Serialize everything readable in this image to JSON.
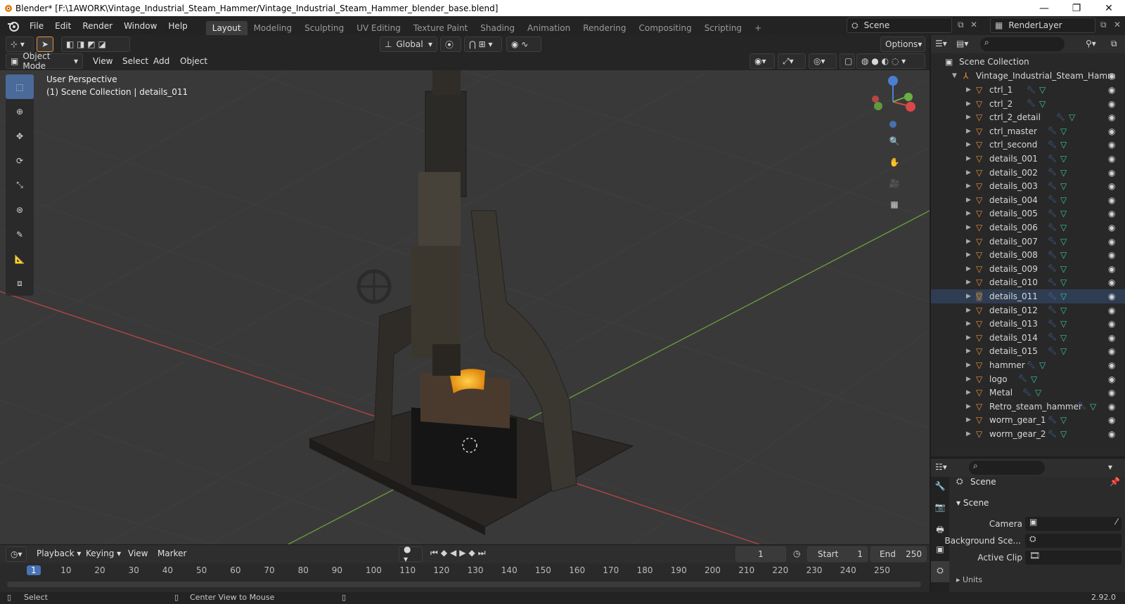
{
  "window": {
    "title": "Blender* [F:\\1AWORK\\Vintage_Industrial_Steam_Hammer/Vintage_Industrial_Steam_Hammer_blender_base.blend]",
    "minimize": "—",
    "restore": "❐",
    "close": "✕"
  },
  "menu": [
    "File",
    "Edit",
    "Render",
    "Window",
    "Help"
  ],
  "workspaces": [
    "Layout",
    "Modeling",
    "Sculpting",
    "UV Editing",
    "Texture Paint",
    "Shading",
    "Animation",
    "Rendering",
    "Compositing",
    "Scripting"
  ],
  "active_workspace": "Layout",
  "scene_field": "Scene",
  "renderlayer_field": "RenderLayer",
  "viewport": {
    "mode": "Object Mode",
    "menus": [
      "View",
      "Select",
      "Add",
      "Object"
    ],
    "transform": "Global",
    "options": "Options",
    "perspective": "User Perspective",
    "collection_info": "(1) Scene Collection | details_011"
  },
  "outliner": {
    "root": "Scene Collection",
    "collection": "Vintage_Industrial_Steam_Hamm",
    "items": [
      "ctrl_1",
      "ctrl_2",
      "ctrl_2_detail",
      "ctrl_master",
      "ctrl_second",
      "details_001",
      "details_002",
      "details_003",
      "details_004",
      "details_005",
      "details_006",
      "details_007",
      "details_008",
      "details_009",
      "details_010",
      "details_011",
      "details_012",
      "details_013",
      "details_014",
      "details_015",
      "hammer",
      "logo",
      "Metal",
      "Retro_steam_hammer",
      "worm_gear_1",
      "worm_gear_2"
    ],
    "selected": "details_011"
  },
  "properties": {
    "context": "Scene",
    "panel": "Scene",
    "camera_label": "Camera",
    "bg_label": "Background Sce...",
    "clip_label": "Active Clip",
    "cut": "Units"
  },
  "timeline": {
    "menus": [
      "Playback",
      "Keying",
      "View",
      "Marker"
    ],
    "current_frame": "1",
    "start_label": "Start",
    "start": "1",
    "end_label": "End",
    "end": "250",
    "ticks": [
      "1",
      "10",
      "20",
      "30",
      "40",
      "50",
      "60",
      "70",
      "80",
      "90",
      "100",
      "110",
      "120",
      "130",
      "140",
      "150",
      "160",
      "170",
      "180",
      "190",
      "200",
      "210",
      "220",
      "230",
      "240",
      "250"
    ]
  },
  "status": {
    "select": "Select",
    "center": "Center View to Mouse",
    "version": "2.92.0"
  },
  "colors": {
    "accent": "#4772b3",
    "object_orange": "#e8903a",
    "x_axis": "#b04040",
    "y_axis": "#6a9a3a"
  }
}
